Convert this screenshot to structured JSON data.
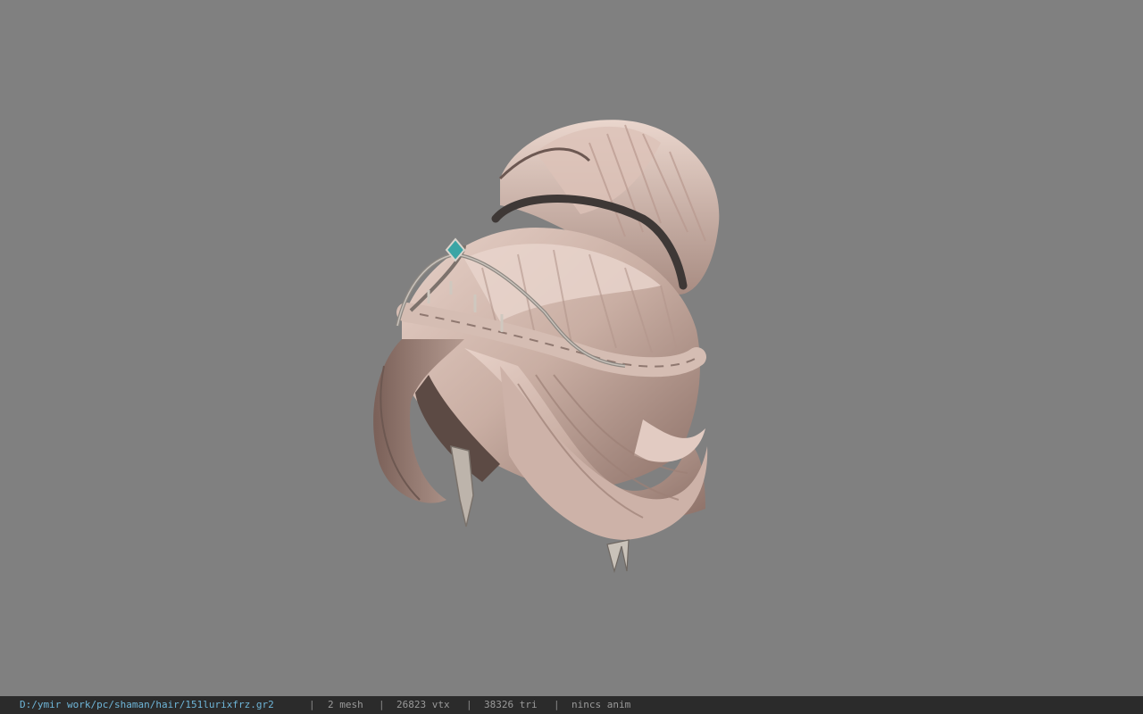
{
  "viewport": {
    "background": "#808080",
    "model_label": "3d-hair-model-render"
  },
  "statusbar": {
    "file_path": "D:/ymir work/pc/shaman/hair/151lurixfrz.gr2",
    "separator": "|",
    "mesh": "2 mesh",
    "vertices": "26823 vtx",
    "triangles": "38326 tri",
    "anim": "nincs anim",
    "accent_color": "#6fb6d9"
  }
}
